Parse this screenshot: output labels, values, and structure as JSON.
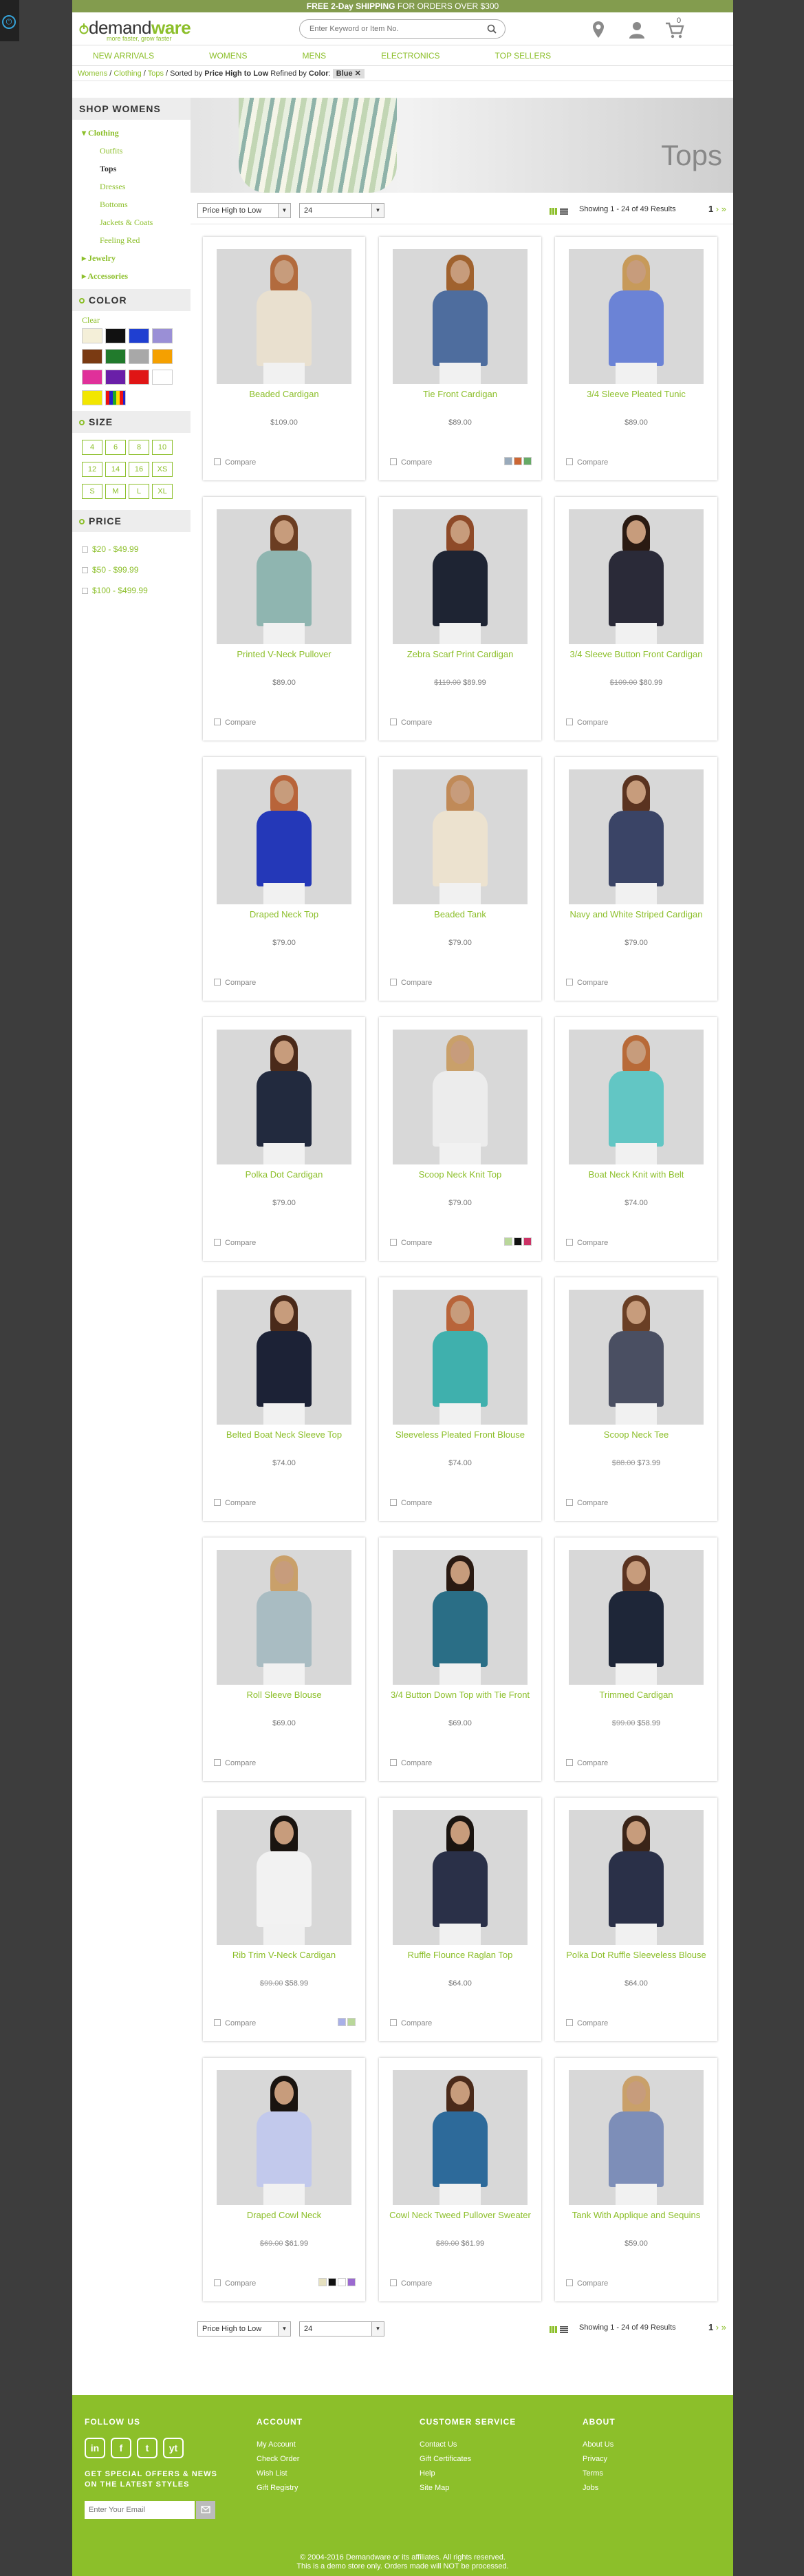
{
  "topbar": {
    "promo_bold": "FREE 2-Day SHIPPING",
    "promo_rest": " FOR ORDERS OVER $300"
  },
  "header": {
    "logo_a": "demand",
    "logo_b": "ware",
    "tagline": "more faster, grow faster",
    "search_placeholder": "Enter Keyword or Item No.",
    "cart_count": "0"
  },
  "nav": [
    "NEW ARRIVALS",
    "WOMENS",
    "MENS",
    "ELECTRONICS",
    "TOP SELLERS"
  ],
  "crumbs": {
    "c1": "Womens",
    "c2": "Clothing",
    "c3": "Tops",
    "sorted_lbl": "Sorted by",
    "sorted_val": "Price High to Low",
    "refined_lbl": "Refined by",
    "refined_key": "Color",
    "refined_val": "Blue"
  },
  "sidebar": {
    "shop_title": "SHOP WOMENS",
    "clothing": "Clothing",
    "subcats": [
      "Outfits",
      "Tops",
      "Dresses",
      "Bottoms",
      "Jackets & Coats",
      "Feeling Red"
    ],
    "jewelry": "Jewelry",
    "accessories": "Accessories",
    "color_title": "COLOR",
    "clear": "Clear",
    "colors": [
      "#f4efd8",
      "#111111",
      "#1f3fd1",
      "#9a8fd6",
      "#7a3a12",
      "#217a2c",
      "#a8a8a8",
      "#f5a000",
      "#e0309a",
      "#6a1fa8",
      "#e01515",
      "#ffffff",
      "#f2e600",
      "#multi"
    ],
    "size_title": "SIZE",
    "sizes": [
      "4",
      "6",
      "8",
      "10",
      "12",
      "14",
      "16",
      "XS",
      "S",
      "M",
      "L",
      "XL"
    ],
    "price_title": "PRICE",
    "prices": [
      "$20 - $49.99",
      "$50 - $99.99",
      "$100 - $499.99"
    ]
  },
  "banner": {
    "title": "Tops"
  },
  "toolbar": {
    "sort": "Price High to Low",
    "per_page": "24",
    "count": "Showing 1 - 24 of 49 Results",
    "page_num": "1"
  },
  "compare_label": "Compare",
  "products": [
    {
      "name": "Beaded Cardigan",
      "price": "$109.00",
      "was": "",
      "body": "#e9e0cf",
      "hair": "#b26b3e",
      "minis": []
    },
    {
      "name": "Tie Front Cardigan",
      "price": "$89.00",
      "was": "",
      "body": "#4e6d9e",
      "hair": "#a0622e",
      "minis": [
        "#9ab",
        "#c63",
        "#6a6"
      ]
    },
    {
      "name": "3/4 Sleeve Pleated Tunic",
      "price": "$89.00",
      "was": "",
      "body": "#6b83d6",
      "hair": "#c79a5a",
      "minis": []
    },
    {
      "name": "Printed V-Neck Pullover",
      "price": "$89.00",
      "was": "",
      "body": "#8fb5b0",
      "hair": "#6b3d22",
      "minis": []
    },
    {
      "name": "Zebra Scarf Print Cardigan",
      "price": "$89.99",
      "was": "$119.00",
      "body": "#1e2433",
      "hair": "#8e4a28",
      "minis": []
    },
    {
      "name": "3/4 Sleeve Button Front Cardigan",
      "price": "$80.99",
      "was": "$109.00",
      "body": "#2a2a38",
      "hair": "#2a1a12",
      "minis": []
    },
    {
      "name": "Draped Neck Top",
      "price": "$79.00",
      "was": "",
      "body": "#2438b8",
      "hair": "#b8643a",
      "minis": []
    },
    {
      "name": "Beaded Tank",
      "price": "$79.00",
      "was": "",
      "body": "#ece2cf",
      "hair": "#c08a58",
      "minis": []
    },
    {
      "name": "Navy and White Striped Cardigan",
      "price": "$79.00",
      "was": "",
      "body": "#3a4466",
      "hair": "#5a3320",
      "minis": []
    },
    {
      "name": "Polka Dot Cardigan",
      "price": "$79.00",
      "was": "",
      "body": "#222a3e",
      "hair": "#4a2a1a",
      "minis": []
    },
    {
      "name": "Scoop Neck Knit Top",
      "price": "$79.00",
      "was": "",
      "body": "#ececec",
      "hair": "#c9a06a",
      "minis": [
        "#b9d79a",
        "#111",
        "#c36"
      ]
    },
    {
      "name": "Boat Neck Knit with Belt",
      "price": "$74.00",
      "was": "",
      "body": "#62c6c4",
      "hair": "#b86a38",
      "minis": []
    },
    {
      "name": "Belted Boat Neck Sleeve Top",
      "price": "$74.00",
      "was": "",
      "body": "#1c2236",
      "hair": "#4a2a1a",
      "minis": []
    },
    {
      "name": "Sleeveless Pleated Front Blouse",
      "price": "$74.00",
      "was": "",
      "body": "#3fb0ad",
      "hair": "#b8643a",
      "minis": []
    },
    {
      "name": "Scoop Neck Tee",
      "price": "$73.99",
      "was": "$88.00",
      "body": "#4a4f62",
      "hair": "#6a3f25",
      "minis": []
    },
    {
      "name": "Roll Sleeve Blouse",
      "price": "$69.00",
      "was": "",
      "body": "#a9bcc2",
      "hair": "#c9a06a",
      "minis": []
    },
    {
      "name": "3/4 Button Down Top with Tie Front",
      "price": "$69.00",
      "was": "",
      "body": "#2a6e86",
      "hair": "#2a1a12",
      "minis": []
    },
    {
      "name": "Trimmed Cardigan",
      "price": "$58.99",
      "was": "$99.00",
      "body": "#1e2638",
      "hair": "#5a3320",
      "minis": []
    },
    {
      "name": "Rib Trim V-Neck Cardigan",
      "price": "$58.99",
      "was": "$99.00",
      "body": "#f2f2f2",
      "hair": "#1a1410",
      "minis": [
        "#a9b0e8",
        "#b9d79a"
      ]
    },
    {
      "name": "Ruffle Flounce Raglan Top",
      "price": "$64.00",
      "was": "",
      "body": "#2a3048",
      "hair": "#1a1410",
      "minis": []
    },
    {
      "name": "Polka Dot Ruffle Sleeveless Blouse",
      "price": "$64.00",
      "was": "",
      "body": "#2a3048",
      "hair": "#3a2418",
      "minis": []
    },
    {
      "name": "Draped Cowl Neck",
      "price": "$61.99",
      "was": "$69.00",
      "body": "#c2c9ec",
      "hair": "#1a1410",
      "minis": [
        "#e6e1c0",
        "#111",
        "#fff",
        "#9b6ad0"
      ]
    },
    {
      "name": "Cowl Neck Tweed Pullover Sweater",
      "price": "$61.99",
      "was": "$89.00",
      "body": "#2d6a9a",
      "hair": "#4a2a1a",
      "minis": []
    },
    {
      "name": "Tank With Applique and Sequins",
      "price": "$59.00",
      "was": "",
      "body": "#7d8eb8",
      "hair": "#c9a06a",
      "minis": []
    }
  ],
  "footer": {
    "follow": "FOLLOW US",
    "social": [
      "in",
      "f",
      "t",
      "yt"
    ],
    "news": "GET SPECIAL OFFERS & NEWS ON THE LATEST STYLES",
    "email_placeholder": "Enter Your Email",
    "account_title": "ACCOUNT",
    "account": [
      "My Account",
      "Check Order",
      "Wish List",
      "Gift Registry"
    ],
    "service_title": "CUSTOMER SERVICE",
    "service": [
      "Contact Us",
      "Gift Certificates",
      "Help",
      "Site Map"
    ],
    "about_title": "ABOUT",
    "about": [
      "About Us",
      "Privacy",
      "Terms",
      "Jobs"
    ],
    "legal1": "© 2004-2016 Demandware or its affiliates. All rights reserved.",
    "legal2": "This is a demo store only. Orders made will NOT be processed."
  }
}
